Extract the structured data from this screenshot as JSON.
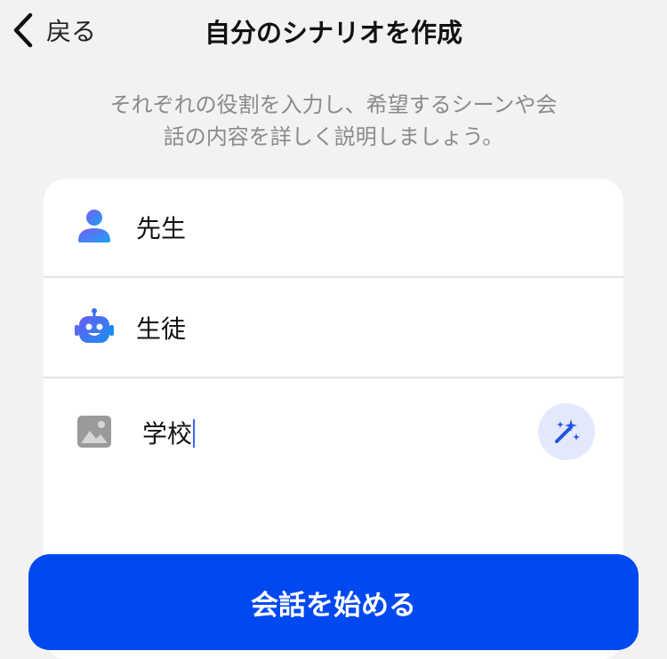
{
  "header": {
    "back_label": "戻る",
    "title": "自分のシナリオを作成"
  },
  "instruction": {
    "line1": "それぞれの役割を入力し、希望するシーンや会",
    "line2": "話の内容を詳しく説明しましょう。"
  },
  "form": {
    "user_role": {
      "value": "先生",
      "icon": "person-icon"
    },
    "ai_role": {
      "value": "生徒",
      "icon": "robot-icon"
    },
    "scene": {
      "value": "学校",
      "icon": "image-icon",
      "action_icon": "magic-wand-icon"
    }
  },
  "start_button_label": "会話を始める",
  "colors": {
    "accent": "#0049f0",
    "background": "#f2f2f2",
    "magic_button_bg": "#e3e9fb",
    "instruction_text": "#8a8a8a"
  }
}
